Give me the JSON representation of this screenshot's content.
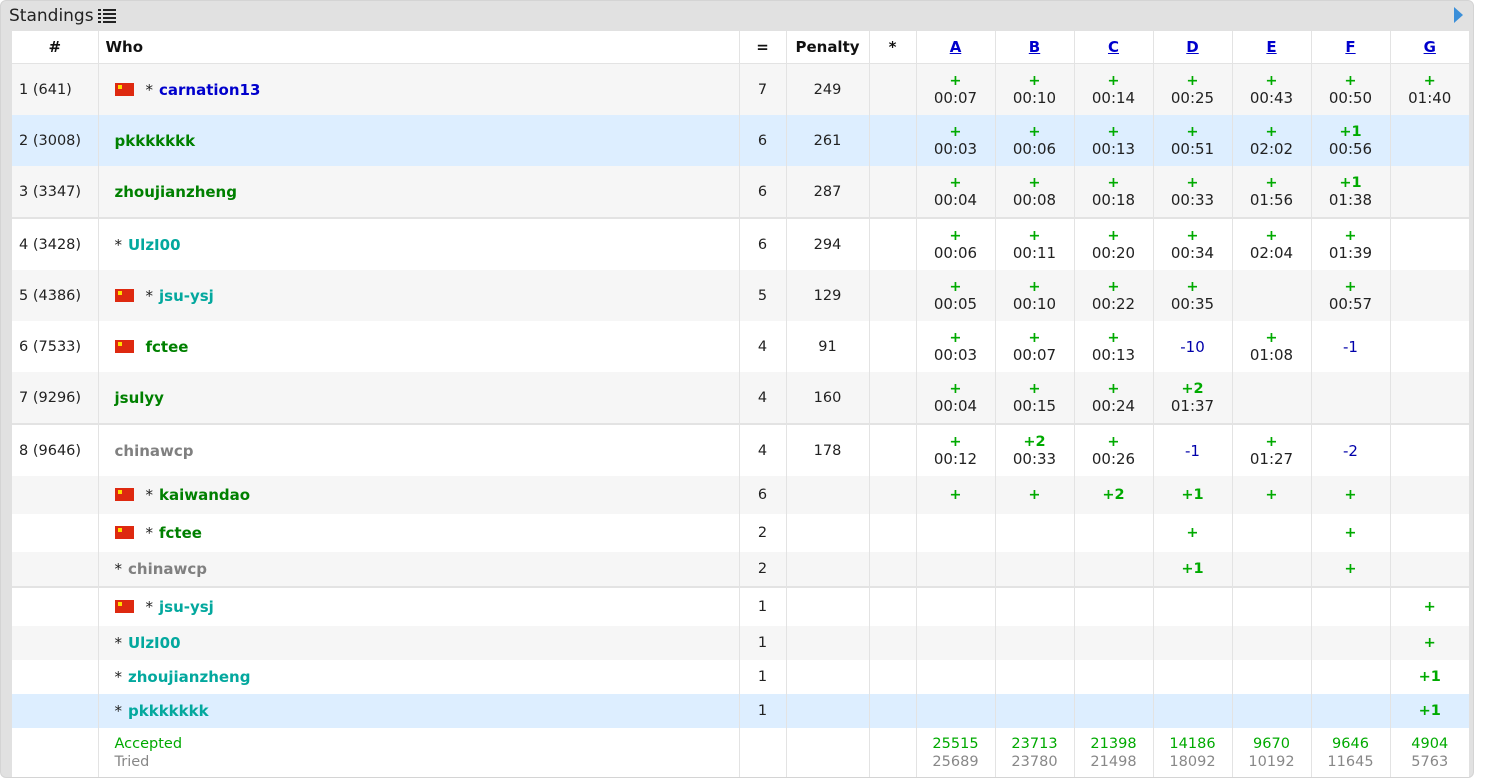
{
  "title": "Standings",
  "header": {
    "rank": "#",
    "who": "Who",
    "solved": "=",
    "penalty": "Penalty",
    "star": "*",
    "problems": [
      "A",
      "B",
      "C",
      "D",
      "E",
      "F",
      "G"
    ]
  },
  "rows": [
    {
      "rank": "1 (641)",
      "flag": true,
      "star": true,
      "name": "carnation13",
      "name_color": "blue",
      "solved": "7",
      "penalty": "249",
      "size": "big",
      "style": "odd",
      "cells": [
        {
          "s": "+",
          "t": "00:07"
        },
        {
          "s": "+",
          "t": "00:10"
        },
        {
          "s": "+",
          "t": "00:14"
        },
        {
          "s": "+",
          "t": "00:25"
        },
        {
          "s": "+",
          "t": "00:43"
        },
        {
          "s": "+",
          "t": "00:50"
        },
        {
          "s": "+",
          "t": "01:40"
        }
      ]
    },
    {
      "rank": "2 (3008)",
      "flag": false,
      "star": false,
      "name": "pkkkkkkk",
      "name_color": "green",
      "solved": "6",
      "penalty": "261",
      "size": "big",
      "style": "hl",
      "cells": [
        {
          "s": "+",
          "t": "00:03"
        },
        {
          "s": "+",
          "t": "00:06"
        },
        {
          "s": "+",
          "t": "00:13"
        },
        {
          "s": "+",
          "t": "00:51"
        },
        {
          "s": "+",
          "t": "02:02"
        },
        {
          "s": "+1",
          "t": "00:56"
        },
        {}
      ]
    },
    {
      "rank": "3 (3347)",
      "flag": false,
      "star": false,
      "name": "zhoujianzheng",
      "name_color": "green",
      "solved": "6",
      "penalty": "287",
      "size": "big",
      "style": "odd",
      "cells": [
        {
          "s": "+",
          "t": "00:04"
        },
        {
          "s": "+",
          "t": "00:08"
        },
        {
          "s": "+",
          "t": "00:18"
        },
        {
          "s": "+",
          "t": "00:33"
        },
        {
          "s": "+",
          "t": "01:56"
        },
        {
          "s": "+1",
          "t": "01:38"
        },
        {}
      ]
    },
    {
      "rank": "4 (3428)",
      "flag": false,
      "star": true,
      "name": "UlzI00",
      "name_color": "cyan",
      "solved": "6",
      "penalty": "294",
      "size": "big",
      "style": "even",
      "sep": true,
      "cells": [
        {
          "s": "+",
          "t": "00:06"
        },
        {
          "s": "+",
          "t": "00:11"
        },
        {
          "s": "+",
          "t": "00:20"
        },
        {
          "s": "+",
          "t": "00:34"
        },
        {
          "s": "+",
          "t": "02:04"
        },
        {
          "s": "+",
          "t": "01:39"
        },
        {}
      ]
    },
    {
      "rank": "5 (4386)",
      "flag": true,
      "star": true,
      "name": "jsu-ysj",
      "name_color": "cyan",
      "solved": "5",
      "penalty": "129",
      "size": "big",
      "style": "odd",
      "cells": [
        {
          "s": "+",
          "t": "00:05"
        },
        {
          "s": "+",
          "t": "00:10"
        },
        {
          "s": "+",
          "t": "00:22"
        },
        {
          "s": "+",
          "t": "00:35"
        },
        {},
        {
          "s": "+",
          "t": "00:57"
        },
        {}
      ]
    },
    {
      "rank": "6 (7533)",
      "flag": true,
      "star": false,
      "name": "fctee",
      "name_color": "green",
      "solved": "4",
      "penalty": "91",
      "size": "big",
      "style": "even",
      "cells": [
        {
          "s": "+",
          "t": "00:03"
        },
        {
          "s": "+",
          "t": "00:07"
        },
        {
          "s": "+",
          "t": "00:13"
        },
        {
          "r": "-10"
        },
        {
          "s": "+",
          "t": "01:08"
        },
        {
          "r": "-1"
        },
        {}
      ]
    },
    {
      "rank": "7 (9296)",
      "flag": false,
      "star": false,
      "name": "jsulyy",
      "name_color": "green",
      "solved": "4",
      "penalty": "160",
      "size": "big",
      "style": "odd",
      "cells": [
        {
          "s": "+",
          "t": "00:04"
        },
        {
          "s": "+",
          "t": "00:15"
        },
        {
          "s": "+",
          "t": "00:24"
        },
        {
          "s": "+2",
          "t": "01:37"
        },
        {},
        {},
        {}
      ]
    },
    {
      "rank": "8 (9646)",
      "flag": false,
      "star": false,
      "name": "chinawcp",
      "name_color": "gray",
      "solved": "4",
      "penalty": "178",
      "size": "big",
      "style": "even",
      "sep": true,
      "cells": [
        {
          "s": "+",
          "t": "00:12"
        },
        {
          "s": "+2",
          "t": "00:33"
        },
        {
          "s": "+",
          "t": "00:26"
        },
        {
          "r": "-1"
        },
        {
          "s": "+",
          "t": "01:27"
        },
        {
          "r": "-2"
        },
        {}
      ]
    },
    {
      "rank": "",
      "flag": true,
      "star": true,
      "name": "kaiwandao",
      "name_color": "green",
      "solved": "6",
      "penalty": "",
      "size": "sm",
      "style": "odd",
      "cells": [
        {
          "s": "+"
        },
        {
          "s": "+"
        },
        {
          "s": "+2"
        },
        {
          "s": "+1"
        },
        {
          "s": "+"
        },
        {
          "s": "+"
        },
        {}
      ]
    },
    {
      "rank": "",
      "flag": true,
      "star": true,
      "name": "fctee",
      "name_color": "green",
      "solved": "2",
      "penalty": "",
      "size": "sm",
      "style": "even",
      "cells": [
        {},
        {},
        {},
        {
          "s": "+"
        },
        {},
        {
          "s": "+"
        },
        {}
      ]
    },
    {
      "rank": "",
      "flag": false,
      "star": true,
      "name": "chinawcp",
      "name_color": "gray",
      "solved": "2",
      "penalty": "",
      "size": "xs",
      "style": "odd",
      "cells": [
        {},
        {},
        {},
        {
          "s": "+1"
        },
        {},
        {
          "s": "+"
        },
        {}
      ]
    },
    {
      "rank": "",
      "flag": true,
      "star": true,
      "name": "jsu-ysj",
      "name_color": "cyan",
      "solved": "1",
      "penalty": "",
      "size": "sm",
      "style": "even",
      "sep": true,
      "cells": [
        {},
        {},
        {},
        {},
        {},
        {},
        {
          "s": "+"
        }
      ]
    },
    {
      "rank": "",
      "flag": false,
      "star": true,
      "name": "UlzI00",
      "name_color": "cyan",
      "solved": "1",
      "penalty": "",
      "size": "xs",
      "style": "odd",
      "cells": [
        {},
        {},
        {},
        {},
        {},
        {},
        {
          "s": "+"
        }
      ]
    },
    {
      "rank": "",
      "flag": false,
      "star": true,
      "name": "zhoujianzheng",
      "name_color": "cyan",
      "solved": "1",
      "penalty": "",
      "size": "xs",
      "style": "even",
      "cells": [
        {},
        {},
        {},
        {},
        {},
        {},
        {
          "s": "+1"
        }
      ]
    },
    {
      "rank": "",
      "flag": false,
      "star": true,
      "name": "pkkkkkkk",
      "name_color": "cyan",
      "solved": "1",
      "penalty": "",
      "size": "xs",
      "style": "hl",
      "cells": [
        {},
        {},
        {},
        {},
        {},
        {},
        {
          "s": "+1"
        }
      ]
    }
  ],
  "footer": {
    "accepted_label": "Accepted",
    "tried_label": "Tried",
    "accepted": [
      "25515",
      "23713",
      "21398",
      "14186",
      "9670",
      "9646",
      "4904"
    ],
    "tried": [
      "25689",
      "23780",
      "21498",
      "18092",
      "10192",
      "11645",
      "5763"
    ]
  },
  "colors": {
    "accepted": "#00aa00",
    "rejected": "#0000aa",
    "highlight_row": "#ddeeff",
    "problem_link": "#0000cc"
  }
}
